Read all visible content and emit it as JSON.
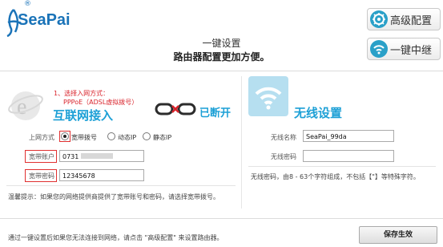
{
  "brand": {
    "name": "SeaPai",
    "reg_mark": "®"
  },
  "header": {
    "title": "一键设置",
    "subtitle": "路由器配置更加方便。"
  },
  "top_buttons": {
    "advanced_label": "高级配置",
    "relay_label": "一键中继"
  },
  "wired": {
    "step_hint": "1、选择入网方式：",
    "pppoe_hint": "PPPoE（ADSL虚拟拨号）",
    "title": "互联网接入",
    "link_status": "已断开",
    "access_label": "上网方式",
    "options": [
      "宽带拨号",
      "动态IP",
      "静态IP"
    ],
    "selected_option": "宽带拨号",
    "account_label": "宽带账户",
    "account_value": "0731",
    "password_label": "宽带密码",
    "password_value": "12345678",
    "tip": "温馨提示：如果您的网络提供商提供了宽带账号和密码，请选择宽带拨号。"
  },
  "wireless": {
    "title": "无线设置",
    "ssid_label": "无线名称",
    "ssid_value": "SeaPai_99da",
    "password_label": "无线密码",
    "password_value": "",
    "password_note": "无线密码，由8 - 63个字符组成，不包括【\"】等特殊字符。"
  },
  "footer": {
    "note": "通过一键设置后如果您无法连接到网络，请点击 \"高级配置\" 来设置路由器。",
    "save_label": "保存生效"
  },
  "colors": {
    "accent_blue": "#1da0d6",
    "hint_red": "#d9232b",
    "brand_blue": "#1a73b8"
  },
  "icons": [
    "seapai-logo-icon",
    "ie-icon",
    "gear-icon",
    "wifi-icon",
    "link-broken-icon"
  ]
}
